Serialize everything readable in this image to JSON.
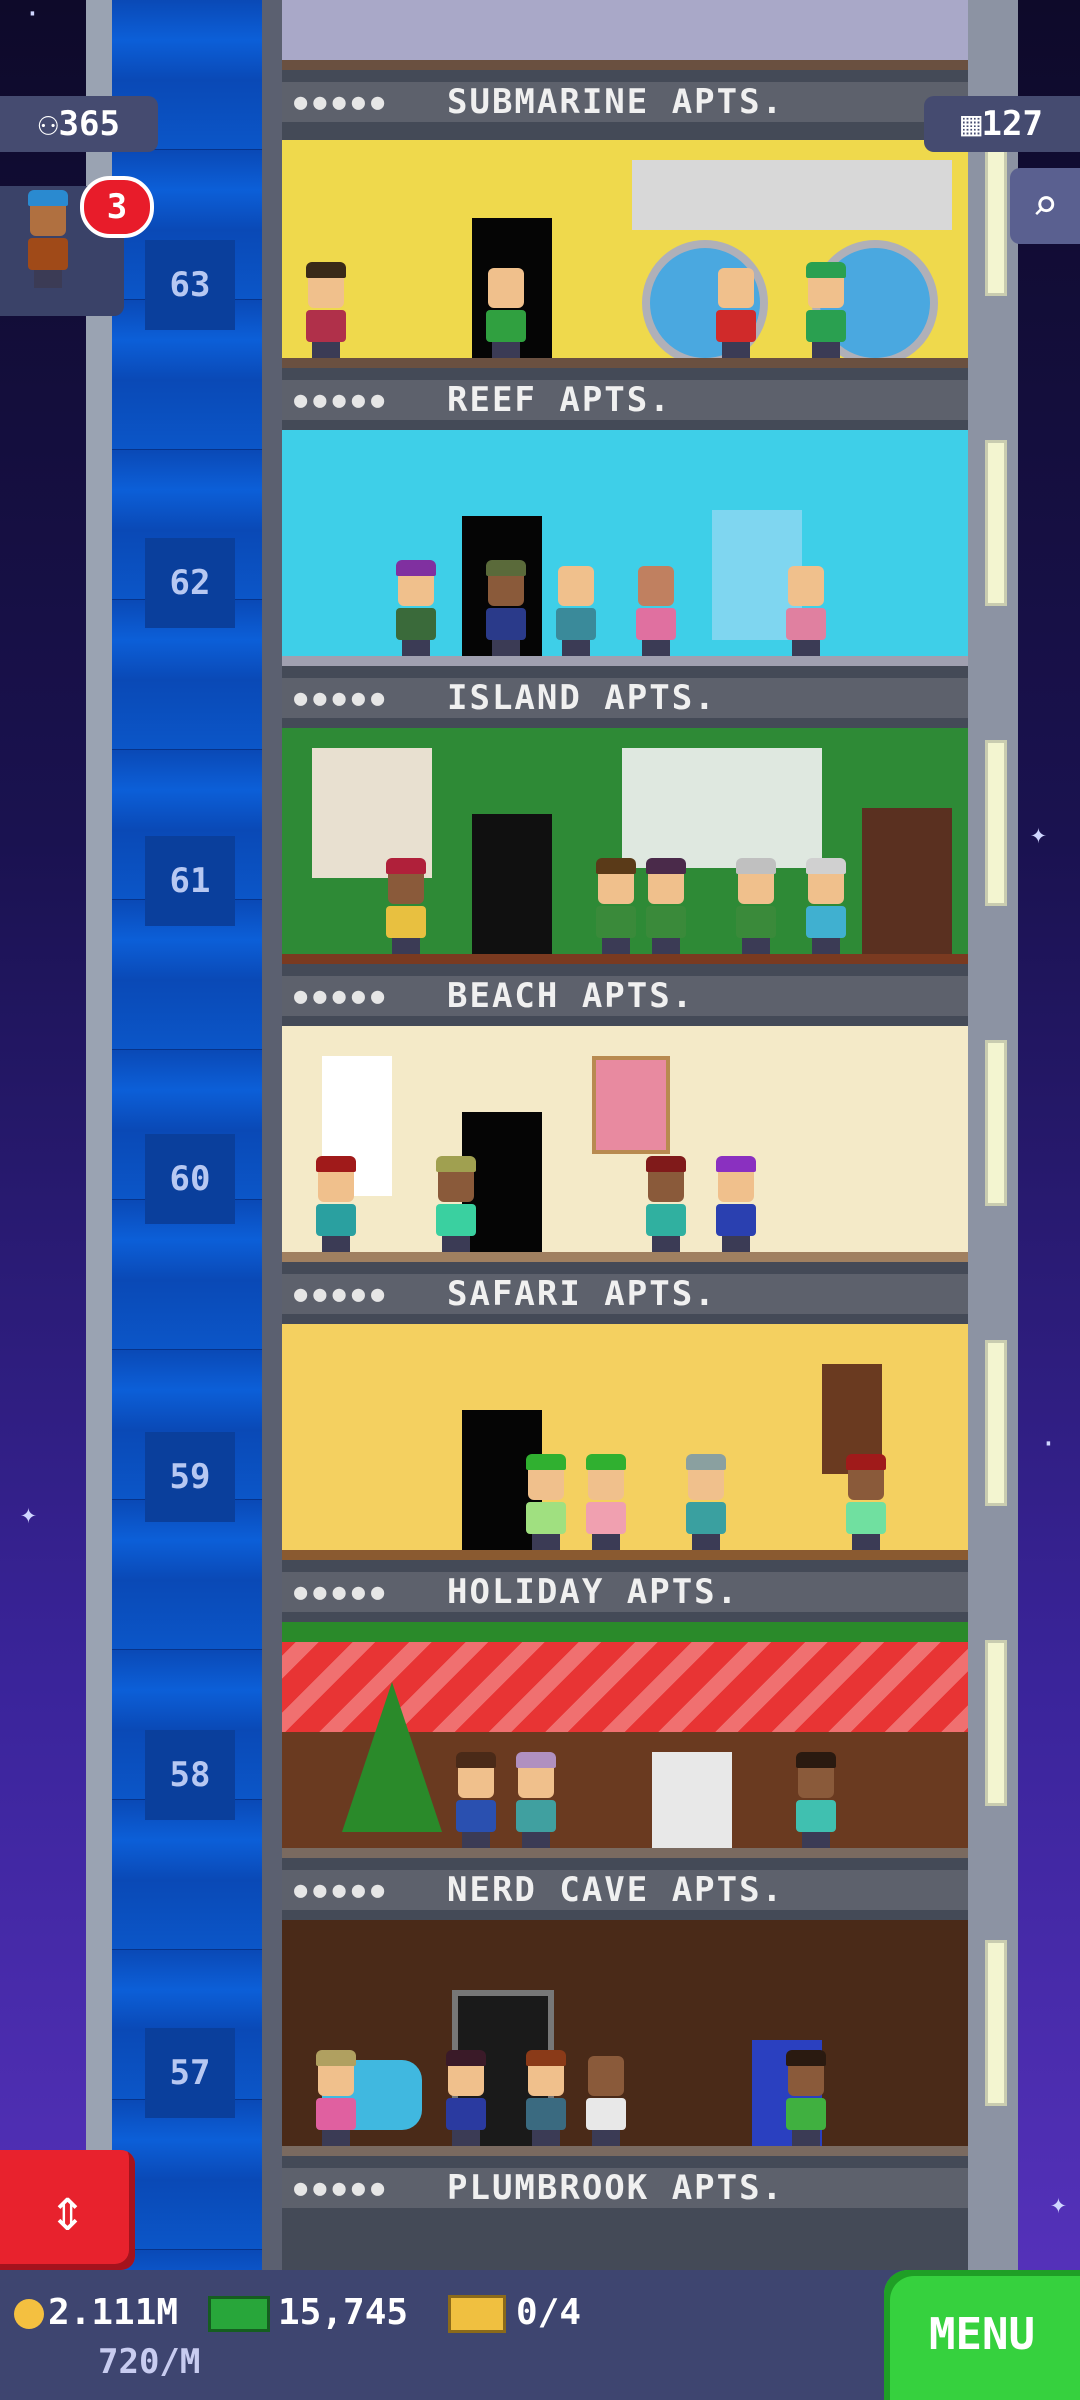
{
  "hud": {
    "population": "365",
    "floor_count": "127",
    "visitor_count": "3"
  },
  "floors": [
    {
      "number": "63",
      "label": "REEF APTS.",
      "theme_color": "#f0e060"
    },
    {
      "number": "62",
      "label": "ISLAND APTS.",
      "theme_color": "#3ecfe8"
    },
    {
      "number": "61",
      "label": "BEACH APTS.",
      "theme_color": "#2e8a36"
    },
    {
      "number": "60",
      "label": "SAFARI APTS.",
      "theme_color": "#f4eac8"
    },
    {
      "number": "59",
      "label": "HOLIDAY APTS.",
      "theme_color": "#f4d060"
    },
    {
      "number": "58",
      "label": "NERD CAVE APTS.",
      "theme_color": "#e83434"
    },
    {
      "number": "57",
      "label": "PLUMBROOK APTS.",
      "theme_color": "#4a2a18"
    }
  ],
  "top_label": "SUBMARINE APTS.",
  "bottom_bar": {
    "coins": "2.111M",
    "bux": "15,745",
    "tickets": "0/4",
    "coin_rate": "720/M",
    "menu_label": "MENU"
  },
  "icons": {
    "population": "person-icon",
    "floors": "building-icon",
    "search": "magnifier-icon",
    "elevator": "up-down-arrows-icon"
  }
}
